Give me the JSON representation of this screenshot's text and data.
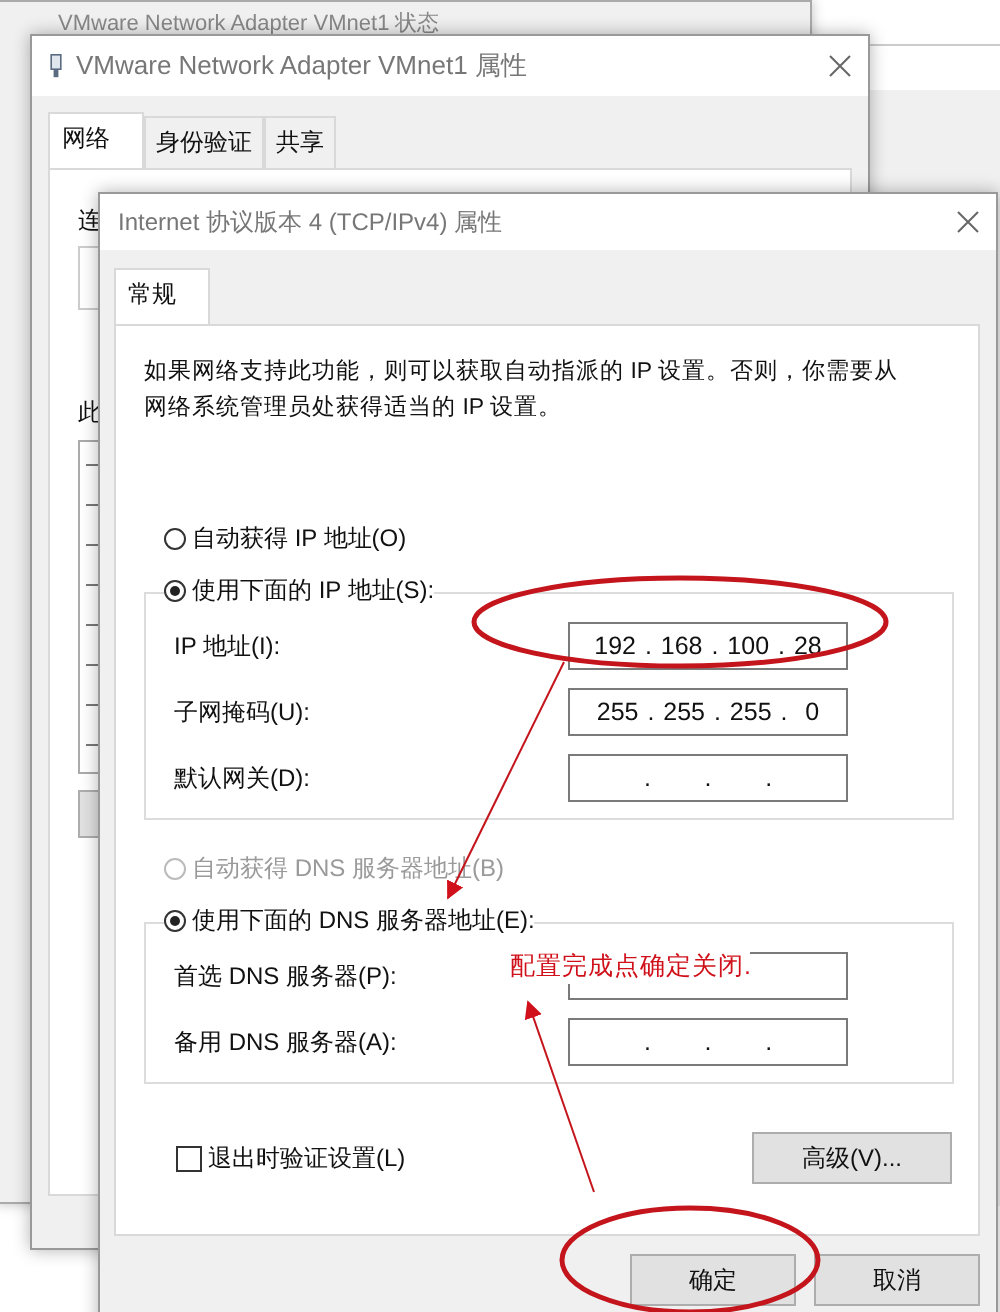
{
  "status_window": {
    "title": "VMware Network Adapter VMnet1 状态"
  },
  "properties_window": {
    "title": "VMware Network Adapter VMnet1 属性",
    "tabs": [
      {
        "label": "网络",
        "selected": true
      },
      {
        "label": "身份验证",
        "selected": false
      },
      {
        "label": "共享",
        "selected": false
      }
    ],
    "fragments": [
      "连",
      "此"
    ]
  },
  "ipv4_window": {
    "title": "Internet 协议版本 4 (TCP/IPv4) 属性",
    "tabs": [
      {
        "label": "常规",
        "selected": true
      }
    ],
    "description": "如果网络支持此功能，则可以获取自动指派的 IP 设置。否则，你需要从网络系统管理员处获得适当的 IP 设置。",
    "ip_options": [
      {
        "label": "自动获得 IP 地址(O)",
        "selected": false,
        "disabled": false
      },
      {
        "label": "使用下面的 IP 地址(S):",
        "selected": true,
        "disabled": false
      }
    ],
    "ip_fields": [
      {
        "label": "IP 地址(I):",
        "value": "192 . 168 . 100 . 28"
      },
      {
        "label": "子网掩码(U):",
        "value": "255 . 255 . 255 .  0"
      },
      {
        "label": "默认网关(D):",
        "value": ".      .      ."
      }
    ],
    "dns_options": [
      {
        "label": "自动获得 DNS 服务器地址(B)",
        "selected": false,
        "disabled": true
      },
      {
        "label": "使用下面的 DNS 服务器地址(E):",
        "selected": true,
        "disabled": false
      }
    ],
    "dns_fields": [
      {
        "label": "首选 DNS 服务器(P):"
      },
      {
        "label": "备用 DNS 服务器(A):",
        "value": ".      .      ."
      }
    ],
    "validate_checkbox": {
      "label": "退出时验证设置(L)",
      "checked": false
    },
    "advanced_button": "高级(V)...",
    "buttons": [
      "确定",
      "取消"
    ]
  },
  "annotation": {
    "text": "配置完成点确定关闭."
  }
}
